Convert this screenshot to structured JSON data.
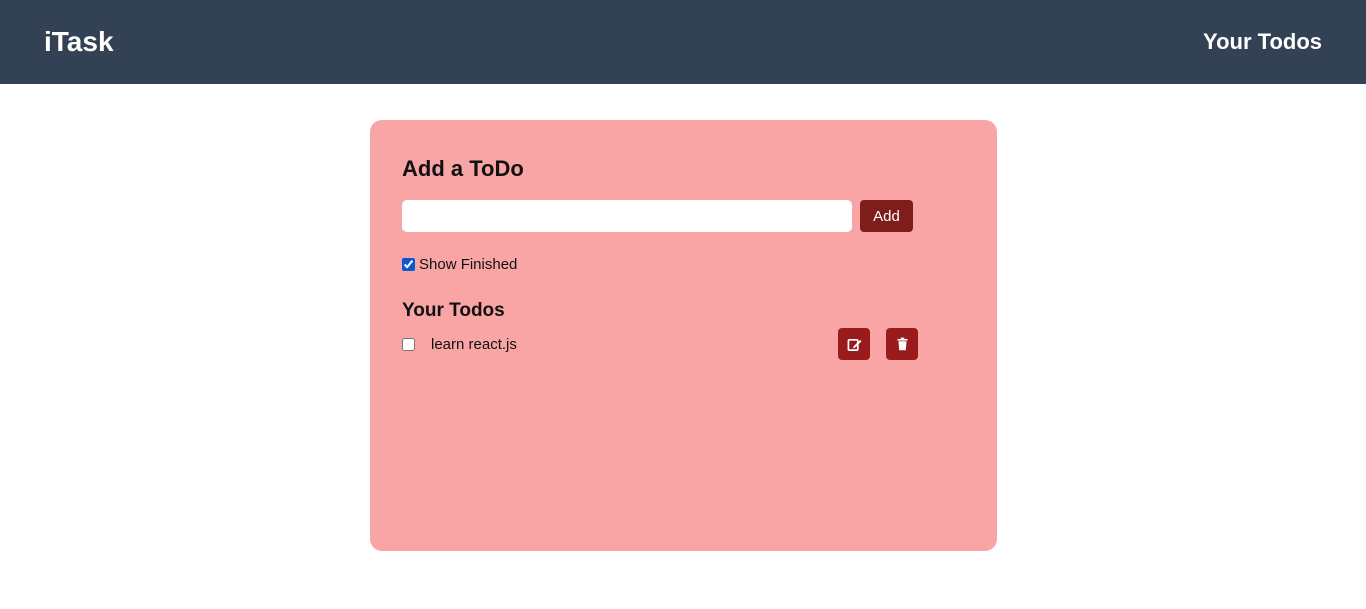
{
  "navbar": {
    "brand": "iTask",
    "link": "Your Todos"
  },
  "card": {
    "heading": "Add a ToDo",
    "input": {
      "value": "",
      "placeholder": ""
    },
    "add_button": "Add",
    "show_finished": {
      "label": "Show Finished",
      "checked": true
    },
    "todos_heading": "Your Todos",
    "todos": [
      {
        "text": "learn react.js",
        "done": false
      }
    ]
  },
  "icons": {
    "edit": "edit-icon",
    "delete": "trash-icon"
  },
  "colors": {
    "navbar": "#334155",
    "card": "#faa5a5",
    "button": "#7f1d1d",
    "icon_button": "#991b1b"
  }
}
